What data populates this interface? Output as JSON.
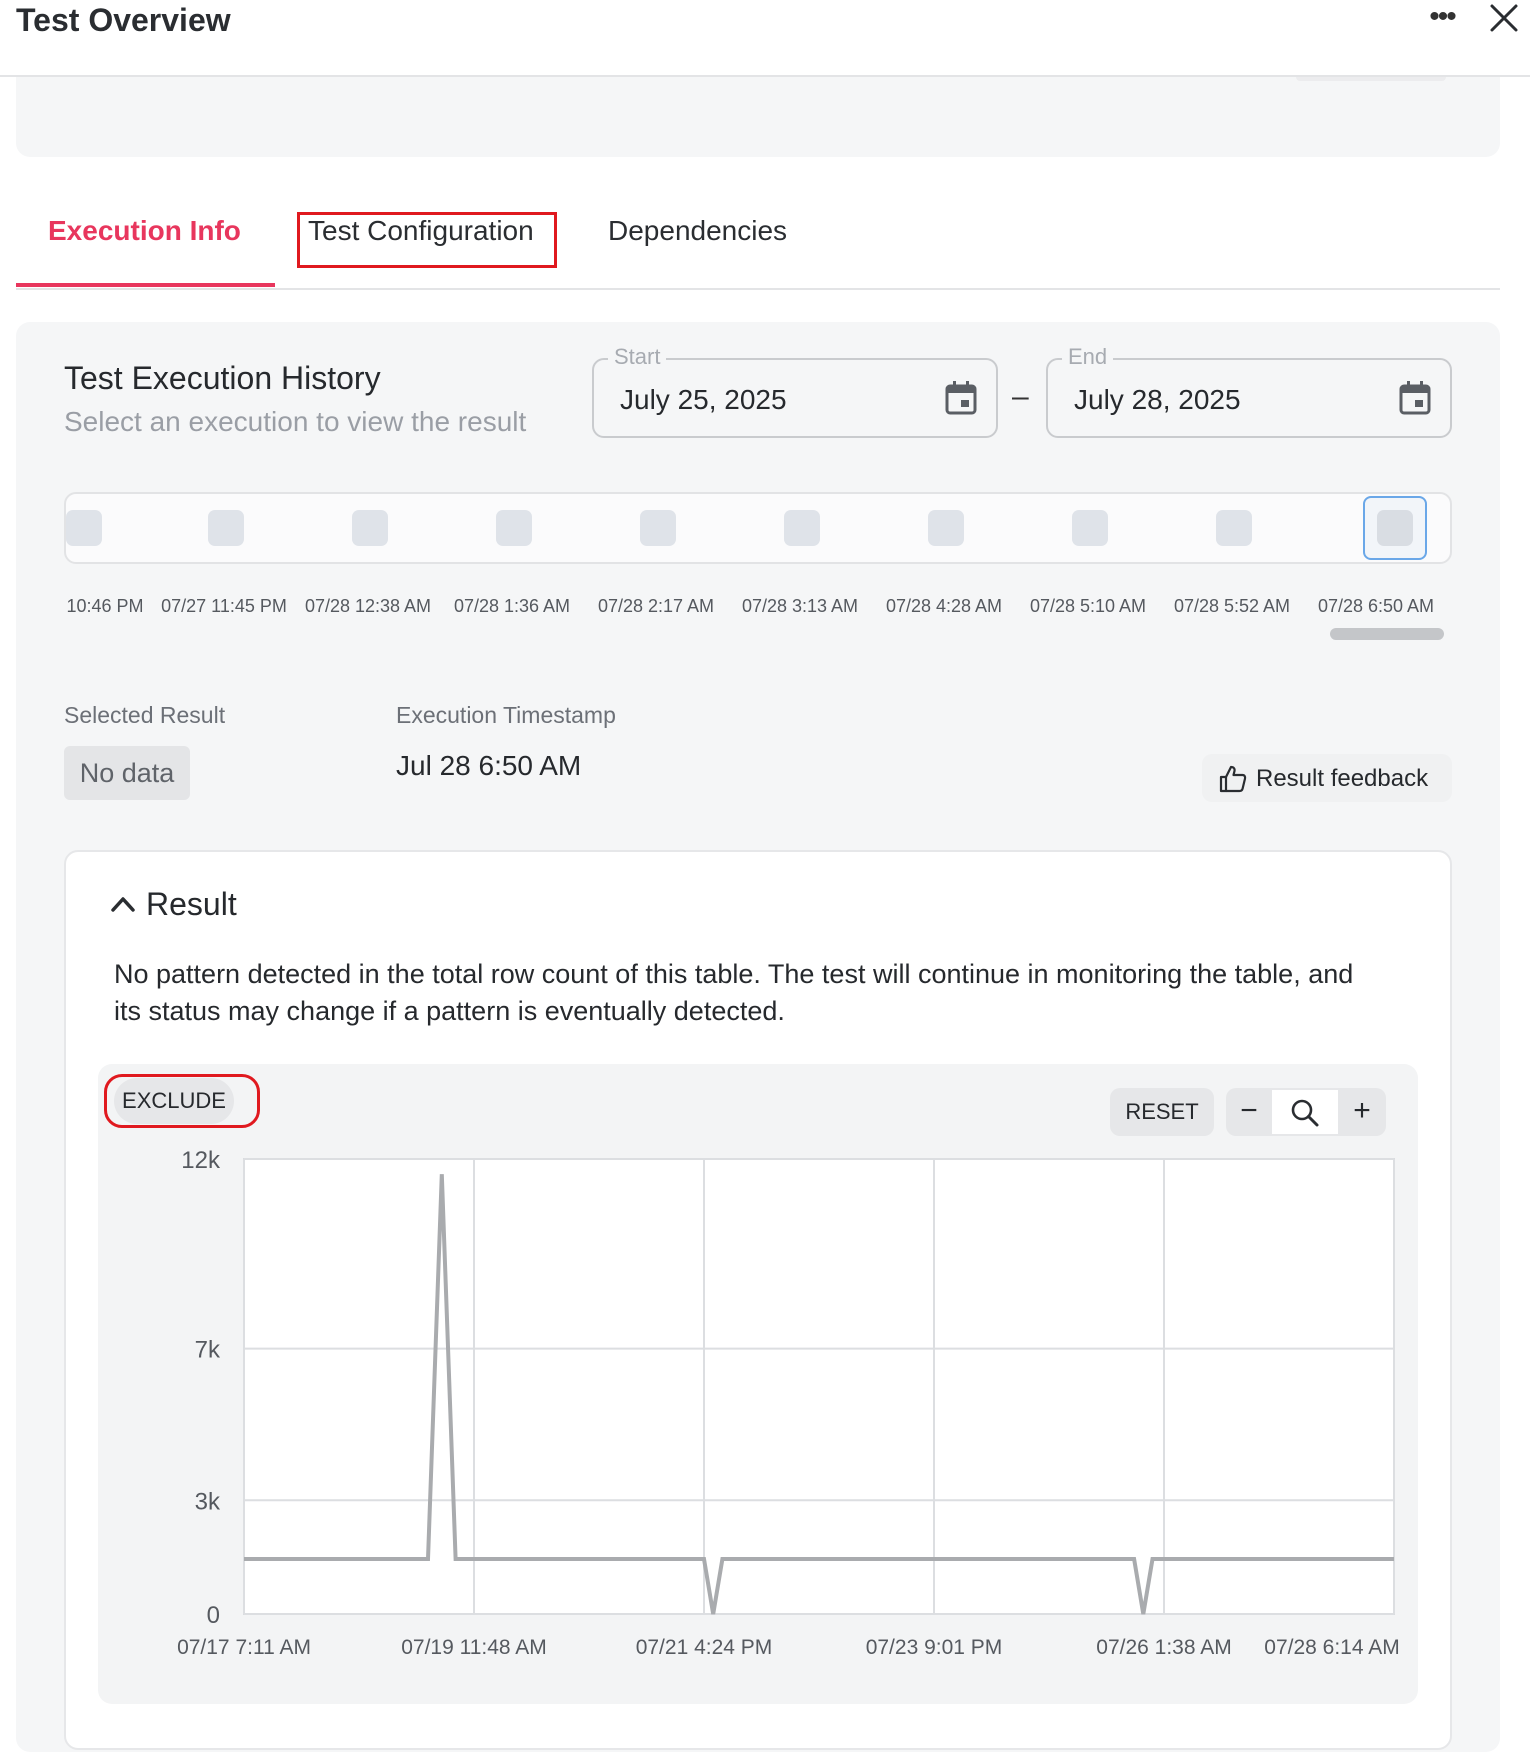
{
  "header": {
    "title": "Test Overview",
    "more_icon": "more-horizontal-icon",
    "close_icon": "close-icon"
  },
  "tabs": [
    {
      "label": "Execution Info",
      "active": true
    },
    {
      "label": "Test Configuration",
      "active": false
    },
    {
      "label": "Dependencies",
      "active": false
    }
  ],
  "history": {
    "title": "Test Execution History",
    "subtitle": "Select an execution to view the result",
    "start": {
      "legend": "Start",
      "value": "July 25, 2025"
    },
    "end": {
      "legend": "End",
      "value": "July 28, 2025"
    },
    "separator": "–",
    "runs": [
      "10:46 PM",
      "07/27 11:45 PM",
      "07/28 12:38 AM",
      "07/28 1:36 AM",
      "07/28 2:17 AM",
      "07/28 3:13 AM",
      "07/28 4:28 AM",
      "07/28 5:10 AM",
      "07/28 5:52 AM",
      "07/28 6:50 AM"
    ],
    "selected_index": 9
  },
  "selection": {
    "selected_result_label": "Selected Result",
    "selected_result_value": "No data",
    "timestamp_label": "Execution Timestamp",
    "timestamp_value": "Jul 28 6:50 AM",
    "feedback_label": "Result feedback"
  },
  "result": {
    "title": "Result",
    "message": "No pattern detected in the total row count of this table. The test will continue in monitoring the table, and its status may change if a pattern is eventually detected.",
    "exclude_label": "EXCLUDE",
    "reset_label": "RESET",
    "zoom_out_label": "−",
    "zoom_in_label": "+"
  },
  "colors": {
    "accent": "#e8365d",
    "highlight": "#e0191f",
    "series": "#a9abae",
    "selected_border": "#6aa7e8"
  },
  "chart_data": {
    "type": "line",
    "title": "",
    "xlabel": "",
    "ylabel": "",
    "y_ticks": [
      {
        "value": 0,
        "label": "0"
      },
      {
        "value": 3000,
        "label": "3k"
      },
      {
        "value": 7000,
        "label": "7k"
      },
      {
        "value": 12000,
        "label": "12k"
      }
    ],
    "ylim": [
      0,
      12000
    ],
    "x_ticks": [
      "07/17 7:11 AM",
      "07/19 11:48 AM",
      "07/21 4:24 PM",
      "07/23 9:01 PM",
      "07/26 1:38 AM",
      "07/28 6:14 AM"
    ],
    "series": [
      {
        "values": [
          {
            "x": 0,
            "y": 1450
          },
          {
            "x": 0.8,
            "y": 1450
          },
          {
            "x": 0.86,
            "y": 11600
          },
          {
            "x": 0.92,
            "y": 1450
          },
          {
            "x": 2.0,
            "y": 1450
          },
          {
            "x": 2.04,
            "y": 0
          },
          {
            "x": 2.08,
            "y": 1450
          },
          {
            "x": 3.87,
            "y": 1450
          },
          {
            "x": 3.91,
            "y": 0
          },
          {
            "x": 3.95,
            "y": 1450
          },
          {
            "x": 5.0,
            "y": 1450
          }
        ]
      }
    ]
  }
}
